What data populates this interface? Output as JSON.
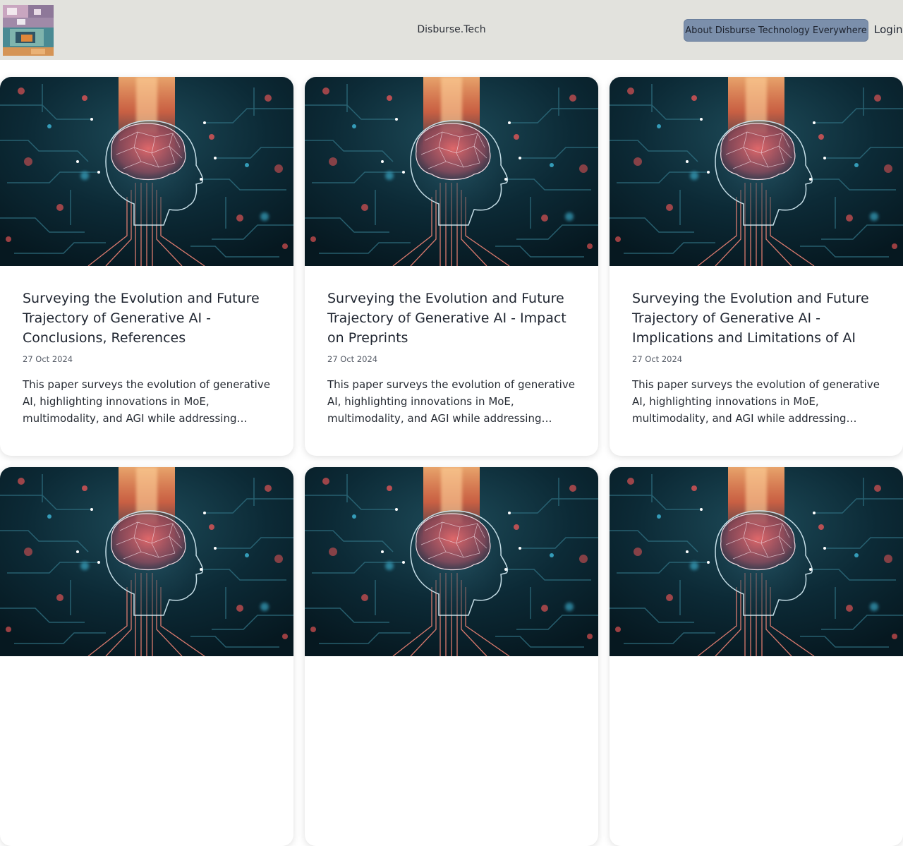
{
  "header": {
    "site_title": "Disburse.Tech",
    "about_button": "About Disburse Technology Everywhere",
    "login_link": "Login"
  },
  "cards": [
    {
      "title": "Surveying the Evolution and Future Trajectory of Generative AI - Conclusions, References",
      "date": "27 Oct 2024",
      "excerpt": "This paper surveys the evolution of generative AI, highlighting innovations in MoE, multimodality, and AGI while addressing ethical and research challenges."
    },
    {
      "title": "Surveying the Evolution and Future Trajectory of Generative AI - Impact on Preprints",
      "date": "27 Oct 2024",
      "excerpt": "This paper surveys the evolution of generative AI, highlighting innovations in MoE, multimodality, and AGI while addressing ethical and research challenges."
    },
    {
      "title": "Surveying the Evolution and Future Trajectory of Generative AI - Implications and Limitations of AI",
      "date": "27 Oct 2024",
      "excerpt": "This paper surveys the evolution of generative AI, highlighting innovations in MoE, multimodality, and AGI while addressing ethical and research challenges."
    },
    {
      "title": "",
      "date": "",
      "excerpt": ""
    },
    {
      "title": "",
      "date": "",
      "excerpt": ""
    },
    {
      "title": "",
      "date": "",
      "excerpt": ""
    }
  ],
  "colors": {
    "header_bg": "#e2e2dd",
    "button_bg": "#7b8fab",
    "image_bg": "#0a2530",
    "accent_glow": "#ff7a45"
  }
}
